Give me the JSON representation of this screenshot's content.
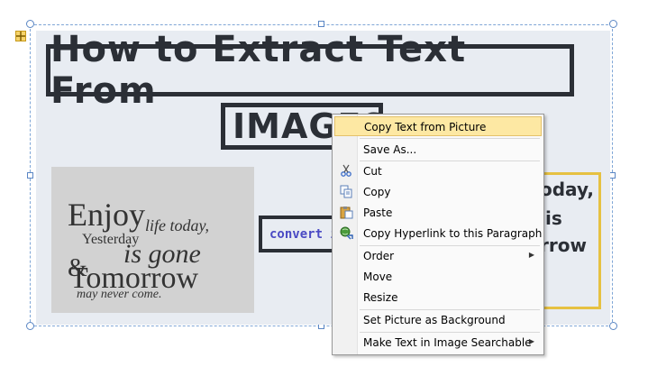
{
  "document": {
    "title_line1": "How to Extract Text From",
    "title_line2": "IMAGES",
    "convert_text": "convert i",
    "right_box_lines": [
      "oday,",
      "is",
      "rrow"
    ],
    "quote_image": {
      "enjoy": "Enjoy",
      "life_today": "life today,",
      "yesterday": "Yesterday",
      "is_gone": "is gone",
      "amp": "&",
      "tomorrow": "Tomorrow",
      "may_never_come": "may never come."
    }
  },
  "context_menu": {
    "items": [
      {
        "label": "Copy Text from Picture",
        "icon": "none",
        "highlighted": true,
        "submenu": false
      },
      {
        "label": "Save As...",
        "icon": "none",
        "highlighted": false,
        "submenu": false
      },
      {
        "label": "Cut",
        "icon": "scissors-icon",
        "highlighted": false,
        "submenu": false
      },
      {
        "label": "Copy",
        "icon": "copy-icon",
        "highlighted": false,
        "submenu": false
      },
      {
        "label": "Paste",
        "icon": "paste-icon",
        "highlighted": false,
        "submenu": false
      },
      {
        "label": "Copy Hyperlink to this Paragraph",
        "icon": "hyperlink-icon",
        "highlighted": false,
        "submenu": false
      },
      {
        "label": "Order",
        "icon": "none",
        "highlighted": false,
        "submenu": true
      },
      {
        "label": "Move",
        "icon": "none",
        "highlighted": false,
        "submenu": false
      },
      {
        "label": "Resize",
        "icon": "none",
        "highlighted": false,
        "submenu": false
      },
      {
        "label": "Set Picture as Background",
        "icon": "none",
        "highlighted": false,
        "submenu": false
      },
      {
        "label": "Make Text in Image Searchable",
        "icon": "none",
        "highlighted": false,
        "submenu": true
      }
    ]
  },
  "colors": {
    "highlight": "#fde8a3",
    "canvas": "#e8ecf2",
    "title_ink": "#2b2f36",
    "convert_text": "#4a4ac4",
    "right_box_border": "#e6c142"
  }
}
